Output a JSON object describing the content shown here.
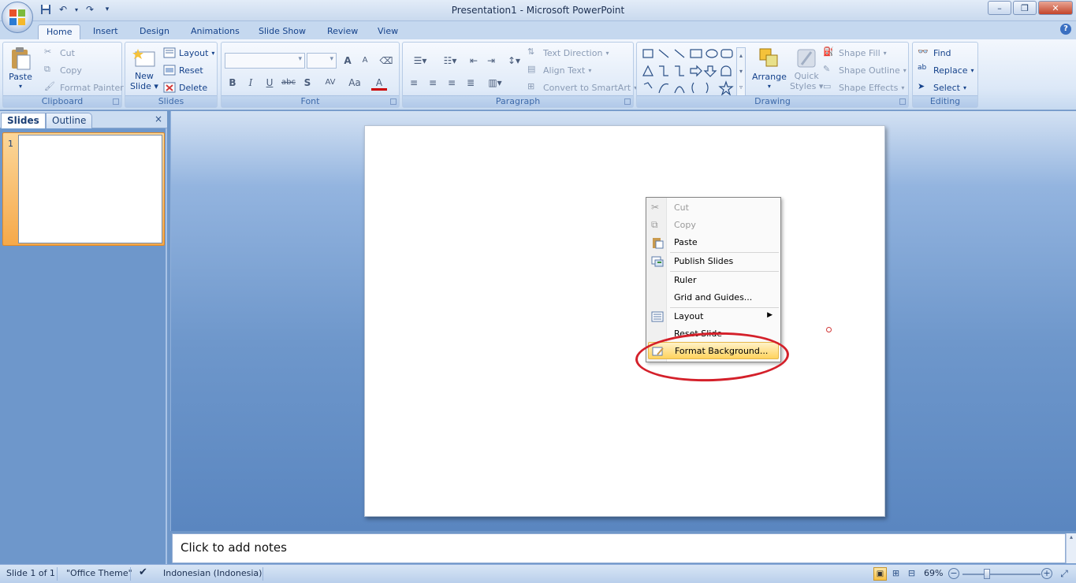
{
  "window": {
    "title": "Presentation1 - Microsoft PowerPoint",
    "minimize": "–",
    "maximize": "❐",
    "close": "✕"
  },
  "ribbon_tabs": [
    "Home",
    "Insert",
    "Design",
    "Animations",
    "Slide Show",
    "Review",
    "View"
  ],
  "help": "?",
  "clipboard": {
    "paste": "Paste",
    "cut": "Cut",
    "copy": "Copy",
    "format_painter": "Format Painter",
    "label": "Clipboard"
  },
  "slides_group": {
    "new_slide_line1": "New",
    "new_slide_line2": "Slide",
    "layout": "Layout",
    "reset": "Reset",
    "delete": "Delete",
    "label": "Slides"
  },
  "font_group": {
    "bold": "B",
    "italic": "I",
    "underline": "U",
    "strike": "abc",
    "shadow": "S",
    "spacing": "AV",
    "case": "Aa",
    "color": "A",
    "grow": "A",
    "shrink": "A",
    "label": "Font"
  },
  "paragraph_group": {
    "text_direction": "Text Direction",
    "align_text": "Align Text",
    "convert_smartart": "Convert to SmartArt",
    "label": "Paragraph"
  },
  "drawing_group": {
    "arrange": "Arrange",
    "quick_styles_line1": "Quick",
    "quick_styles_line2": "Styles",
    "shape_fill": "Shape Fill",
    "shape_outline": "Shape Outline",
    "shape_effects": "Shape Effects",
    "label": "Drawing"
  },
  "editing_group": {
    "find": "Find",
    "replace": "Replace",
    "select": "Select",
    "label": "Editing"
  },
  "pane": {
    "tab_slides": "Slides",
    "tab_outline": "Outline",
    "close": "×",
    "slide_number": "1"
  },
  "notes": {
    "placeholder": "Click to add notes"
  },
  "status": {
    "slide": "Slide 1 of 1",
    "theme": "\"Office Theme\"",
    "language": "Indonesian (Indonesia)",
    "zoom": "69%"
  },
  "context_menu": [
    {
      "label": "Cut",
      "disabled": true,
      "icon": "scissors-icon"
    },
    {
      "label": "Copy",
      "disabled": true,
      "icon": "copy-icon"
    },
    {
      "label": "Paste",
      "disabled": false,
      "icon": "paste-icon"
    },
    {
      "label": "Publish Slides",
      "disabled": false,
      "icon": "publish-icon"
    },
    {
      "label": "Ruler",
      "disabled": false
    },
    {
      "label": "Grid and Guides...",
      "disabled": false
    },
    {
      "label": "Layout",
      "disabled": false,
      "icon": "layout-icon",
      "submenu": true
    },
    {
      "label": "Reset Slide",
      "disabled": false
    },
    {
      "label": "Format Background...",
      "disabled": false,
      "icon": "format-background-icon",
      "highlighted": true
    }
  ],
  "colors": {
    "accent": "#15428b",
    "highlight": "#ffd35e",
    "annotation": "#d4202a"
  }
}
